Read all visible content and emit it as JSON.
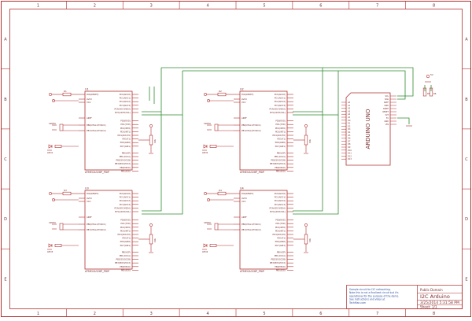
{
  "frame": {
    "columns": [
      "1",
      "2",
      "3",
      "4",
      "5",
      "6",
      "7",
      "8"
    ],
    "rows": [
      "A",
      "B",
      "C",
      "D",
      "E"
    ]
  },
  "colors": {
    "border": "#b03030",
    "wire": "#2e8b2e",
    "part": "#b03030",
    "text": "#7a2a2a",
    "label": "#3050a0"
  },
  "chips": [
    {
      "ref": "U1",
      "name": "ATMEGA328P_PDIP",
      "left_pins": [
        "PC6(RESET)",
        "AVCC",
        "VCC",
        "AREF",
        "PB6(XTAL1/TOSC1)",
        "PB7(XTAL2/TOSC2)"
      ],
      "right_pins": [
        "PC0(ADC0)",
        "PC1(ADC1)",
        "PC2(ADC2)",
        "PC3(ADC3)",
        "PC4(ADC4/SDA)",
        "PC5(ADC5/SCL)",
        "PD0(RXD)",
        "PD1(TXD)",
        "PD2(INT0)",
        "PD3(INT1)",
        "PD4(XCK/T0)",
        "PD5(T1)",
        "PD6(AIN0)",
        "PD7(AIN1)",
        "PB0(ICP)",
        "PB1(OC1A)",
        "PB2(SS/OC1B)",
        "PB3(MOSI/OC2)",
        "PB4(MISO)",
        "PB5(SCK)"
      ],
      "crystal": "16MHz",
      "res": "R1",
      "pot": "10k",
      "led": "LED1"
    },
    {
      "ref": "U2",
      "name": "ATMEGA328P_PDIP",
      "left_pins": [
        "PC6(RESET)",
        "AVCC",
        "VCC",
        "AREF",
        "PB6(XTAL1/TOSC1)",
        "PB7(XTAL2/TOSC2)"
      ],
      "right_pins": [
        "PC0(ADC0)",
        "PC1(ADC1)",
        "PC2(ADC2)",
        "PC3(ADC3)",
        "PC4(ADC4/SDA)",
        "PC5(ADC5/SCL)",
        "PD0(RXD)",
        "PD1(TXD)",
        "PD2(INT0)",
        "PD3(INT1)",
        "PD4(XCK/T0)",
        "PD5(T1)",
        "PD6(AIN0)",
        "PD7(AIN1)",
        "PB0(ICP)",
        "PB1(OC1A)",
        "PB2(SS/OC1B)",
        "PB3(MOSI/OC2)",
        "PB4(MISO)",
        "PB5(SCK)"
      ],
      "crystal": "16MHz",
      "res": "R2",
      "pot": "10k",
      "led": "LED2"
    },
    {
      "ref": "U3",
      "name": "ATMEGA328P_PDIP",
      "left_pins": [
        "PC6(RESET)",
        "AVCC",
        "VCC",
        "AREF",
        "PB6(XTAL1/TOSC1)",
        "PB7(XTAL2/TOSC2)"
      ],
      "right_pins": [
        "PC0(ADC0)",
        "PC1(ADC1)",
        "PC2(ADC2)",
        "PC3(ADC3)",
        "PC4(ADC4/SDA)",
        "PC5(ADC5/SCL)",
        "PD0(RXD)",
        "PD1(TXD)",
        "PD2(INT0)",
        "PD3(INT1)",
        "PD4(XCK/T0)",
        "PD5(T1)",
        "PD6(AIN0)",
        "PD7(AIN1)",
        "PB0(ICP)",
        "PB1(OC1A)",
        "PB2(SS/OC1B)",
        "PB3(MOSI/OC2)",
        "PB4(MISO)",
        "PB5(SCK)"
      ],
      "crystal": "16MHz",
      "res": "R3",
      "pot": "10k",
      "led": "LED3"
    },
    {
      "ref": "U4",
      "name": "ATMEGA328P_PDIP",
      "left_pins": [
        "PC6(RESET)",
        "AVCC",
        "VCC",
        "AREF",
        "PB6(XTAL1/TOSC1)",
        "PB7(XTAL2/TOSC2)"
      ],
      "right_pins": [
        "PC0(ADC0)",
        "PC1(ADC1)",
        "PC2(ADC2)",
        "PC3(ADC3)",
        "PC4(ADC4/SDA)",
        "PC5(ADC5/SCL)",
        "PD0(RXD)",
        "PD1(TXD)",
        "PD2(INT0)",
        "PD3(INT1)",
        "PD4(XCK/T0)",
        "PD5(T1)",
        "PD6(AIN0)",
        "PD7(AIN1)",
        "PB0(ICP)",
        "PB1(OC1A)",
        "PB2(SS/OC1B)",
        "PB3(MOSI/OC2)",
        "PB4(MISO)",
        "PB5(SCK)"
      ],
      "crystal": "16MHz",
      "res": "R4",
      "pot": "10k",
      "led": "LED4"
    }
  ],
  "uno": {
    "title": "ARDUINO UNO",
    "left_pins": [
      "A0",
      "A1",
      "A2",
      "A3",
      "A4",
      "A5",
      "D0",
      "D1",
      "D2",
      "D3",
      "D4",
      "D5",
      "D6",
      "D7",
      "D8",
      "D9",
      "D10",
      "D11",
      "D12",
      "D13"
    ],
    "right_pins": [
      "SCL",
      "SDA",
      "AREF",
      "GND",
      "IOREF",
      "RESET",
      "3V3",
      "5V",
      "GND",
      "VIN"
    ],
    "res_a": "R5",
    "res_b": "R6",
    "supply": "5V"
  },
  "titleblock": {
    "notes": [
      "Sample circuit for I2C networking.",
      "Note this is not a finalized circuit but it's",
      "operational for the purpose of the demo.",
      "See instructions and video at",
      "TechMan.com"
    ],
    "license": "Public Domain",
    "title": "I2C Arduino",
    "date": "3/25/2014 5:31:58 PM",
    "sheet": "Sheet: 1/1"
  }
}
